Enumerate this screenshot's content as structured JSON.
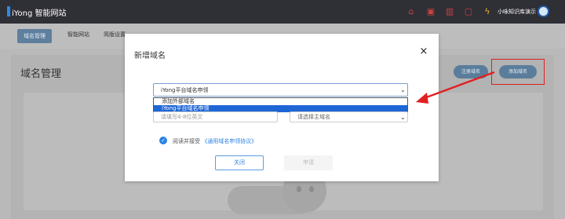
{
  "header": {
    "logo": "iYong 智能网站",
    "user": "小咏知识库演示",
    "icons": [
      "home-icon",
      "monitor-icon",
      "chart-icon",
      "box-icon",
      "lightning-icon"
    ],
    "accent": "#d0413e"
  },
  "tabs": [
    {
      "label": "域名管理",
      "active": true
    },
    {
      "label": "智能网站"
    },
    {
      "label": "简版设置"
    }
  ],
  "page": {
    "title": "域名管理",
    "register_btn": "注册域名",
    "add_btn": "添加域名"
  },
  "modal": {
    "title": "新增域名",
    "close_glyph": "×",
    "source_select": {
      "value": "iYong平台域名申领",
      "options": [
        "添加外部域名",
        "iYong平台域名申领"
      ],
      "selected_index": 1
    },
    "prefix_input_placeholder": "请填写4-8位英文",
    "root_select_placeholder": "请选择主域名",
    "agree_text": "阅读并接受",
    "agree_link": "《通用域名申领协议》",
    "close_btn": "关闭",
    "apply_btn": "申请"
  },
  "colors": {
    "primary": "#2a82e4",
    "highlight": "#e02020",
    "selection": "#1e66d6"
  }
}
